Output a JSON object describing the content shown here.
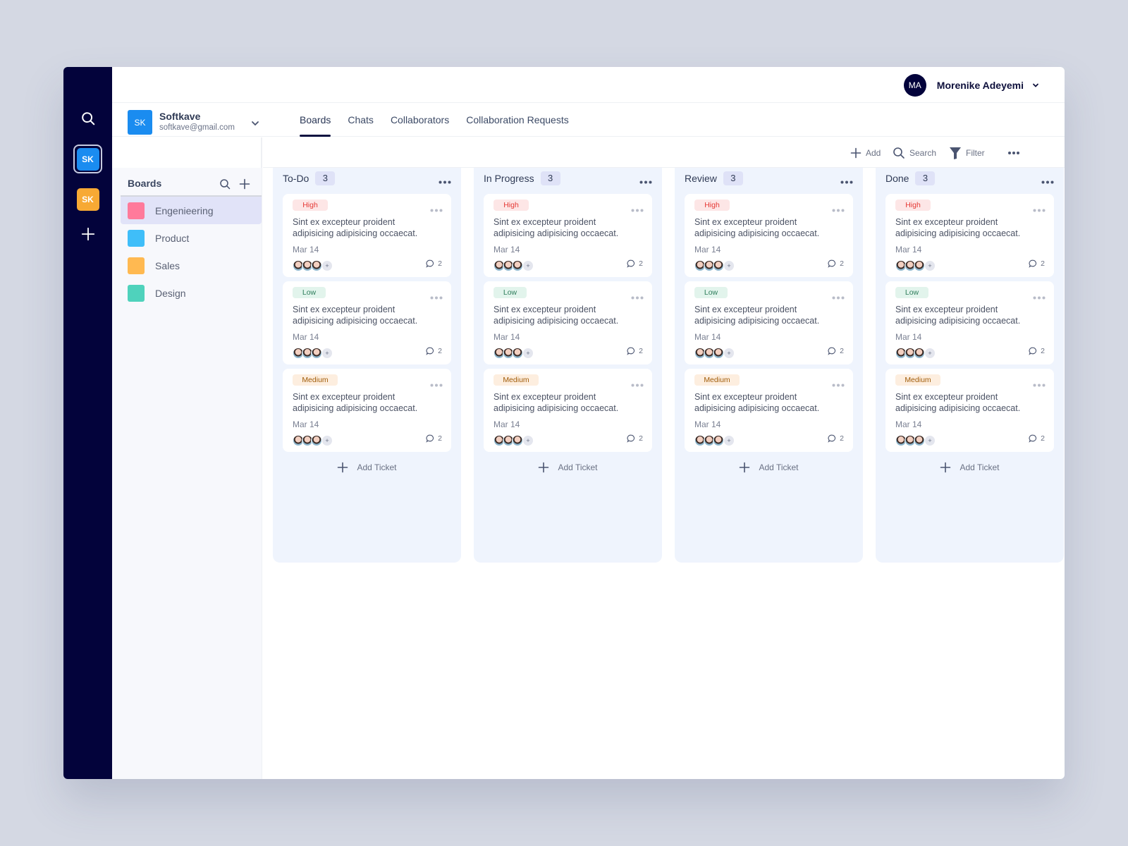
{
  "rail": {
    "icons": [
      "search-icon",
      "plus-icon"
    ],
    "workspaces": [
      {
        "initials": "SK",
        "color": "#1a8cf0",
        "active": true
      },
      {
        "initials": "SK",
        "color": "#f7a934",
        "active": false
      }
    ]
  },
  "user": {
    "initials": "MA",
    "name": "Morenike Adeyemi"
  },
  "workspace": {
    "initials": "SK",
    "name": "Softkave",
    "email": "softkave@gmail.com"
  },
  "tabs": [
    {
      "label": "Boards",
      "active": true
    },
    {
      "label": "Chats",
      "active": false
    },
    {
      "label": "Collaborators",
      "active": false
    },
    {
      "label": "Collaboration Requests",
      "active": false
    }
  ],
  "toolbar": {
    "add_label": "Add",
    "search_label": "Search",
    "filter_label": "Filter"
  },
  "boards": {
    "title": "Boards",
    "items": [
      {
        "label": "Engenieering",
        "color": "#ff7a9b",
        "active": true
      },
      {
        "label": "Product",
        "color": "#3fbef9",
        "active": false
      },
      {
        "label": "Sales",
        "color": "#ffb951",
        "active": false
      },
      {
        "label": "Design",
        "color": "#4fd2bc",
        "active": false
      }
    ]
  },
  "priority_labels": {
    "high": "High",
    "low": "Low",
    "medium": "Medium"
  },
  "columns": [
    {
      "title": "To-Do",
      "count": "3",
      "add_label": "Add Ticket",
      "cards": [
        {
          "priority": "High",
          "text": "Sint ex excepteur proident adipisicing adipisicing occaecat.",
          "date": "Mar 14",
          "comments": "2",
          "more_assignees": "+"
        },
        {
          "priority": "Low",
          "text": "Sint ex excepteur proident adipisicing adipisicing occaecat.",
          "date": "Mar 14",
          "comments": "2",
          "more_assignees": "+"
        },
        {
          "priority": "Medium",
          "text": "Sint ex excepteur proident adipisicing adipisicing occaecat.",
          "date": "Mar 14",
          "comments": "2",
          "more_assignees": "+"
        }
      ]
    },
    {
      "title": "In Progress",
      "count": "3",
      "add_label": "Add Ticket",
      "cards": [
        {
          "priority": "High",
          "text": "Sint ex excepteur proident adipisicing adipisicing occaecat.",
          "date": "Mar 14",
          "comments": "2",
          "more_assignees": "+"
        },
        {
          "priority": "Low",
          "text": "Sint ex excepteur proident adipisicing adipisicing occaecat.",
          "date": "Mar 14",
          "comments": "2",
          "more_assignees": "+"
        },
        {
          "priority": "Medium",
          "text": "Sint ex excepteur proident adipisicing adipisicing occaecat.",
          "date": "Mar 14",
          "comments": "2",
          "more_assignees": "+"
        }
      ]
    },
    {
      "title": "Review",
      "count": "3",
      "add_label": "Add Ticket",
      "cards": [
        {
          "priority": "High",
          "text": "Sint ex excepteur proident adipisicing adipisicing occaecat.",
          "date": "Mar 14",
          "comments": "2",
          "more_assignees": "+"
        },
        {
          "priority": "Low",
          "text": "Sint ex excepteur proident adipisicing adipisicing occaecat.",
          "date": "Mar 14",
          "comments": "2",
          "more_assignees": "+"
        },
        {
          "priority": "Medium",
          "text": "Sint ex excepteur proident adipisicing adipisicing occaecat.",
          "date": "Mar 14",
          "comments": "2",
          "more_assignees": "+"
        }
      ]
    },
    {
      "title": "Done",
      "count": "3",
      "add_label": "Add Ticket",
      "cards": [
        {
          "priority": "High",
          "text": "Sint ex excepteur proident adipisicing adipisicing occaecat.",
          "date": "Mar 14",
          "comments": "2",
          "more_assignees": "+"
        },
        {
          "priority": "Low",
          "text": "Sint ex excepteur proident adipisicing adipisicing occaecat.",
          "date": "Mar 14",
          "comments": "2",
          "more_assignees": "+"
        },
        {
          "priority": "Medium",
          "text": "Sint ex excepteur proident adipisicing adipisicing occaecat.",
          "date": "Mar 14",
          "comments": "2",
          "more_assignees": "+"
        }
      ]
    }
  ]
}
